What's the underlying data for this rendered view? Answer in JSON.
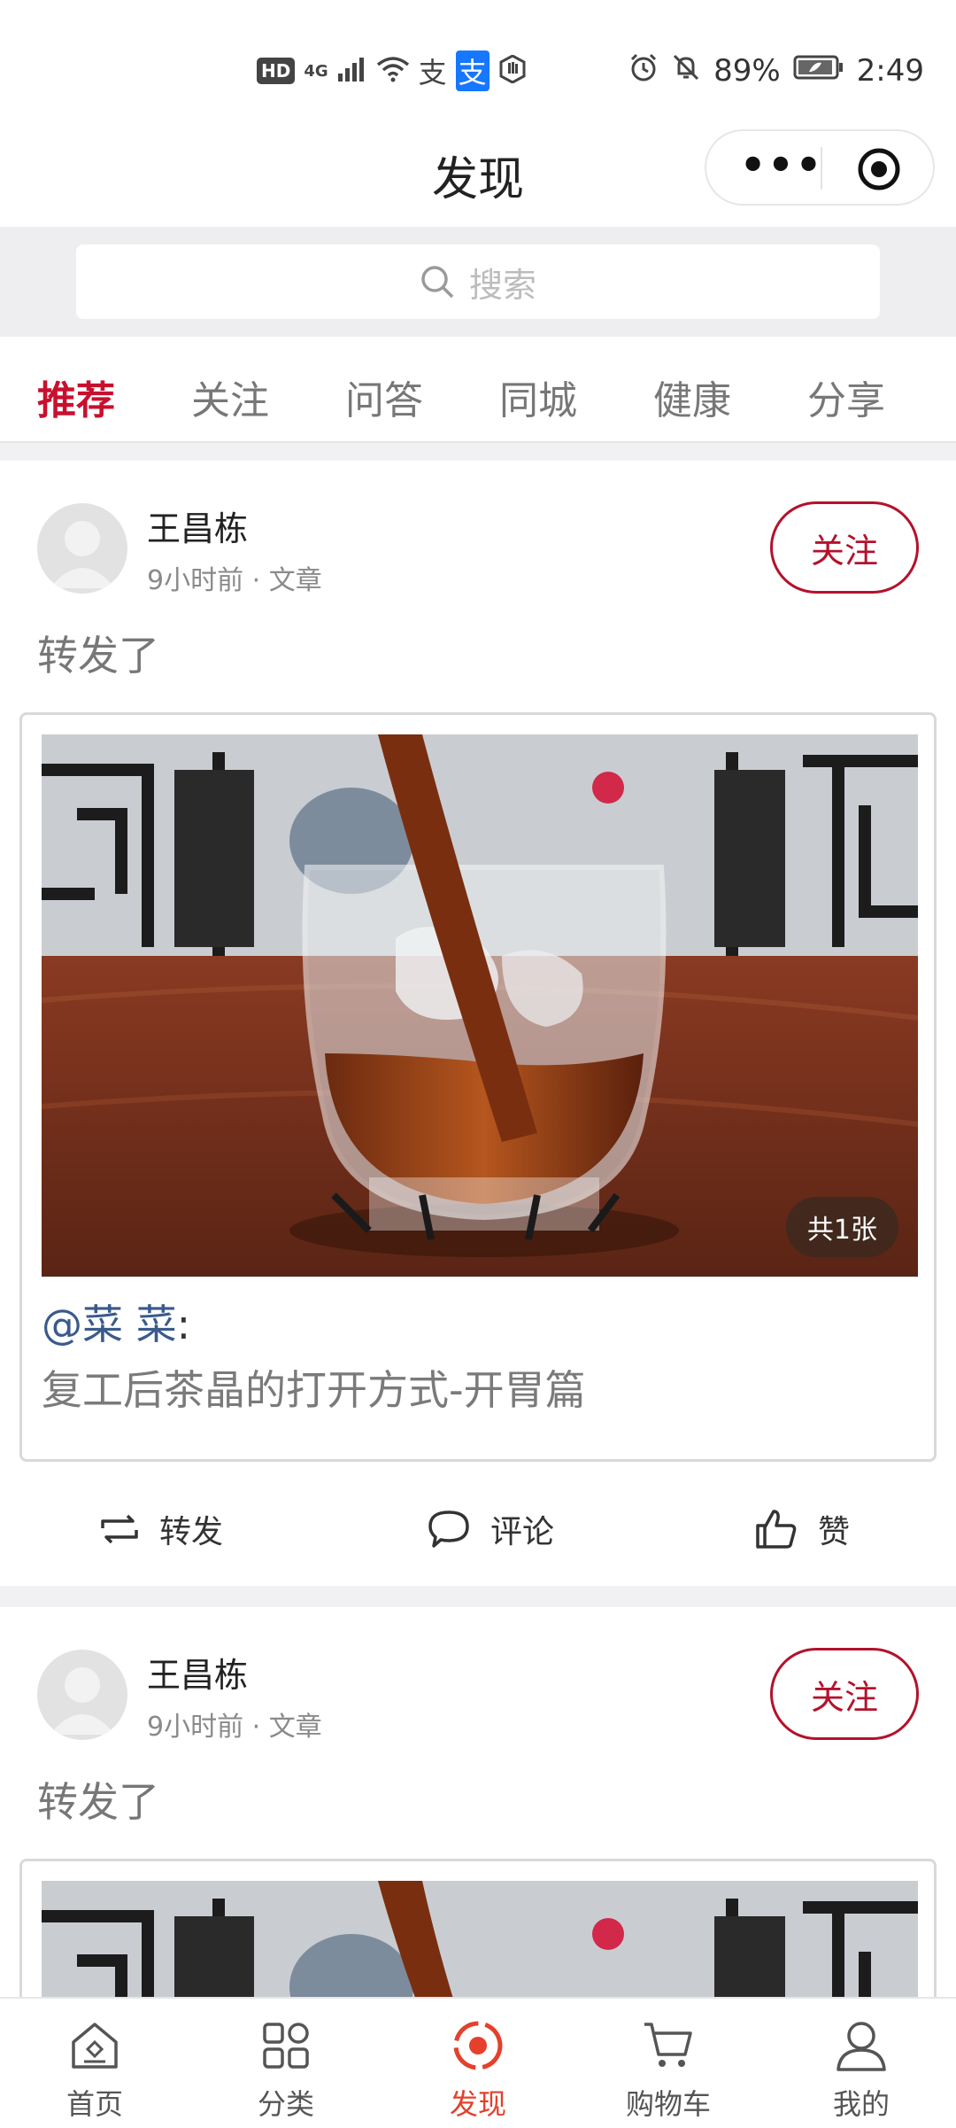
{
  "status_bar": {
    "hd": "HD",
    "network": "4G",
    "battery": "89%",
    "time": "2:49",
    "icons": [
      "hd-icon",
      "signal-icon",
      "wifi-icon",
      "alipay-icon",
      "alipay-blue-icon",
      "hand-icon",
      "alarm-icon",
      "mute-icon",
      "battery-icon"
    ]
  },
  "header": {
    "title": "发现",
    "more_label": "•••"
  },
  "search": {
    "placeholder": "搜索"
  },
  "tabs": [
    {
      "label": "推荐",
      "active": true
    },
    {
      "label": "关注"
    },
    {
      "label": "问答"
    },
    {
      "label": "同城"
    },
    {
      "label": "健康"
    },
    {
      "label": "分享"
    }
  ],
  "posts": [
    {
      "author": "王昌栋",
      "meta": "9小时前 · 文章",
      "follow_label": "关注",
      "repost_text": "转发了",
      "card": {
        "image_count": "共1张",
        "mention": "@菜 菜",
        "colon": ":",
        "title": "复工后茶晶的打开方式-开胃篇"
      },
      "actions": {
        "share": "转发",
        "comment": "评论",
        "like": "赞"
      }
    },
    {
      "author": "王昌栋",
      "meta": "9小时前 · 文章",
      "follow_label": "关注",
      "repost_text": "转发了"
    }
  ],
  "bottom_nav": [
    {
      "label": "首页",
      "icon": "home-icon"
    },
    {
      "label": "分类",
      "icon": "category-icon"
    },
    {
      "label": "发现",
      "icon": "discover-icon",
      "active": true
    },
    {
      "label": "购物车",
      "icon": "cart-icon"
    },
    {
      "label": "我的",
      "icon": "profile-icon"
    }
  ],
  "colors": {
    "accent": "#c8102e",
    "nav_active": "#e4402c",
    "mention": "#3a5a8c"
  }
}
